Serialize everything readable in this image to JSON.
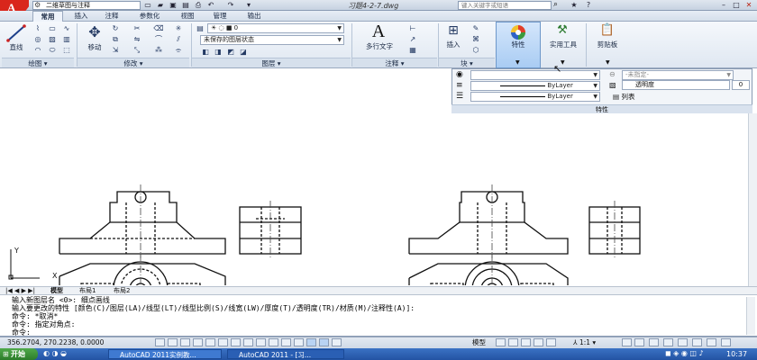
{
  "title_bar": {
    "workspace": "二维草图与注释",
    "document_title": "习题4-2-7.dwg",
    "search_placeholder": "键入关键字或短语"
  },
  "menu_tabs": [
    "常用",
    "插入",
    "注释",
    "参数化",
    "视图",
    "管理",
    "输出"
  ],
  "ribbon": {
    "draw": {
      "line_label": "直线",
      "panel_label": "绘图"
    },
    "modify": {
      "move_label": "移动",
      "panel_label": "修改"
    },
    "layers": {
      "layer_state": "未保存的图层状态",
      "panel_label": "图层"
    },
    "annotation": {
      "text_label": "多行文字",
      "panel_label": "注释"
    },
    "block": {
      "insert_label": "插入",
      "panel_label": "块"
    },
    "properties_label": "特性",
    "utilities_label": "实用工具",
    "clipboard_label": "剪贴板"
  },
  "properties_flyout": {
    "linetype_1": "ByLayer",
    "linetype_2": "ByLayer",
    "plot_style": "-未指定-",
    "transparency_label": "透明度",
    "transparency_value": "0",
    "list_label": "列表",
    "title": "特性"
  },
  "ucs": {
    "y_label": "Y",
    "x_label": "X"
  },
  "layout_tabs": [
    "模型",
    "布局1",
    "布局2"
  ],
  "command_lines": [
    "输入新图层名 <0>: 细点画线",
    "输入要更改的特性 [颜色(C)/图层(LA)/线型(LT)/线型比例(S)/线宽(LW)/厚度(T)/透明度(TR)/材质(M)/注释性(A)]:",
    "命令: *取消*",
    "命令: 指定对角点:",
    "命令:"
  ],
  "status": {
    "coordinates": "356.2704, 270.2238, 0.0000",
    "model_label": "模型",
    "annotation_scale": "1:1"
  },
  "taskbar": {
    "start_label": "开始",
    "task_1": "AutoCAD 2011实例教...",
    "task_2": "AutoCAD 2011 - [习...",
    "clock": "10:37"
  },
  "colors": {
    "title_bg": "#c6d2e1",
    "ribbon_bg": "#dfe7f1",
    "accent": "#d9261c",
    "taskbar": "#2353a3"
  }
}
